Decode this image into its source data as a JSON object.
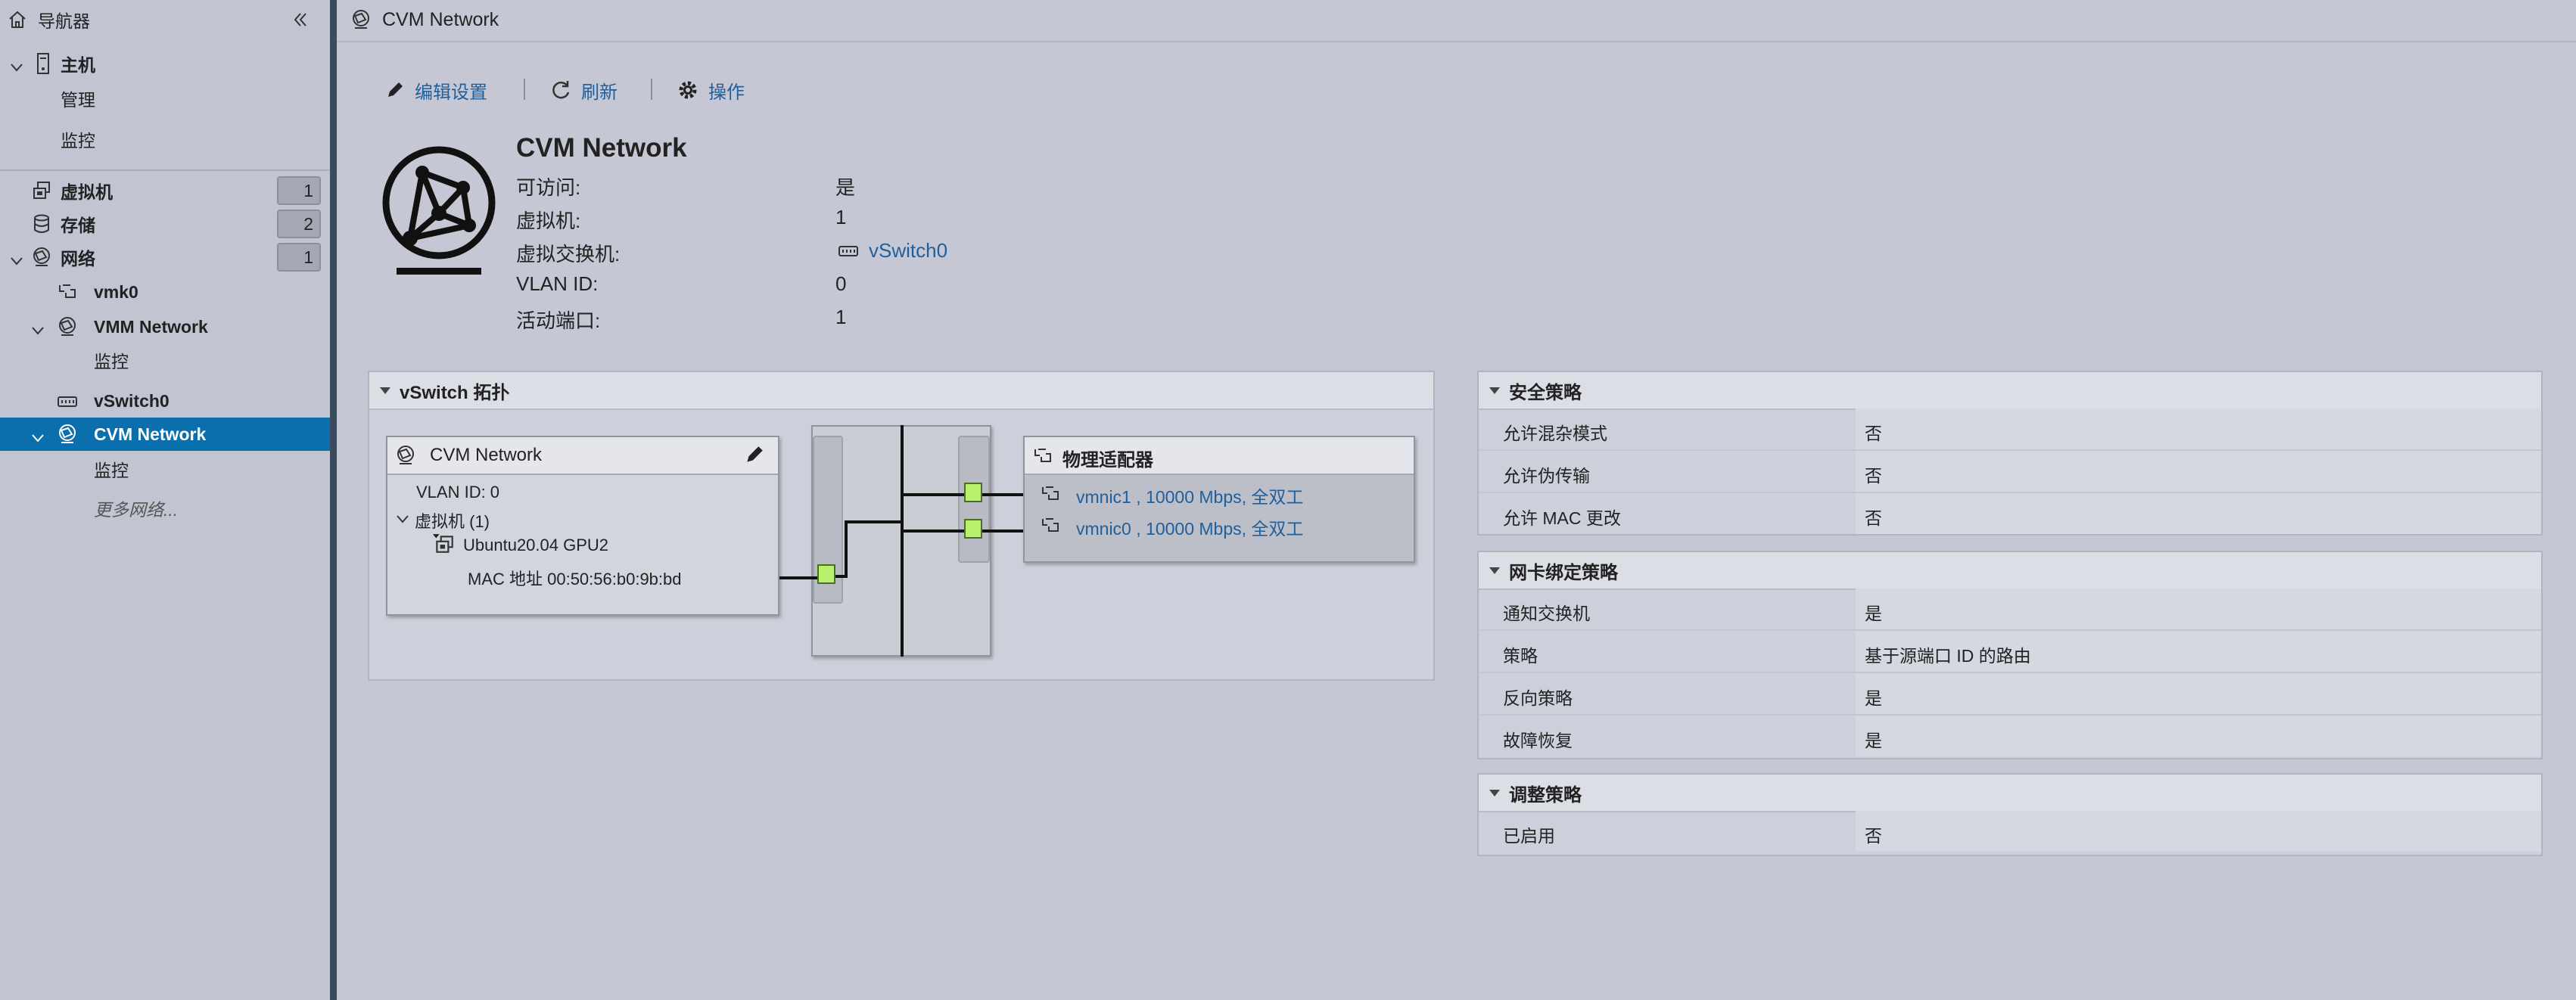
{
  "sidebar": {
    "title": "导航器",
    "host": "主机",
    "host_children": [
      "管理",
      "监控"
    ],
    "vm": {
      "label": "虚拟机",
      "count": "1"
    },
    "storage": {
      "label": "存储",
      "count": "2"
    },
    "network": {
      "label": "网络",
      "count": "1"
    },
    "vmk0": "vmk0",
    "vmm_network": "VMM Network",
    "vmm_monitor": "监控",
    "vswitch0": "vSwitch0",
    "cvm_network": "CVM Network",
    "cvm_monitor": "监控",
    "more": "更多网络..."
  },
  "header": {
    "title": "CVM Network"
  },
  "toolbar": {
    "edit": "编辑设置",
    "refresh": "刷新",
    "actions": "操作"
  },
  "summary": {
    "name": "CVM Network",
    "rows": [
      {
        "key": "可访问:",
        "value": "是"
      },
      {
        "key": "虚拟机:",
        "value": "1"
      },
      {
        "key": "虚拟交换机:",
        "value": "vSwitch0"
      },
      {
        "key": "VLAN ID:",
        "value": "0"
      },
      {
        "key": "活动端口:",
        "value": "1"
      }
    ]
  },
  "topology": {
    "title": "vSwitch 拓扑",
    "portgroup": {
      "name": "CVM Network",
      "vlan": "VLAN ID: 0",
      "vm_group": "虚拟机 (1)",
      "vm_name": "Ubuntu20.04 GPU2",
      "mac": "MAC 地址 00:50:56:b0:9b:bd"
    },
    "adapters": {
      "title": "物理适配器",
      "items": [
        "vmnic1 , 10000 Mbps, 全双工",
        "vmnic0 , 10000 Mbps, 全双工"
      ]
    }
  },
  "security": {
    "title": "安全策略",
    "rows": [
      {
        "key": "允许混杂模式",
        "value": "否"
      },
      {
        "key": "允许伪传输",
        "value": "否"
      },
      {
        "key": "允许 MAC 更改",
        "value": "否"
      }
    ]
  },
  "teaming": {
    "title": "网卡绑定策略",
    "rows": [
      {
        "key": "通知交换机",
        "value": "是"
      },
      {
        "key": "策略",
        "value": "基于源端口 ID 的路由"
      },
      {
        "key": "反向策略",
        "value": "是"
      },
      {
        "key": "故障恢复",
        "value": "是"
      }
    ]
  },
  "shaping": {
    "title": "调整策略",
    "rows": [
      {
        "key": "已启用",
        "value": "否"
      }
    ]
  },
  "colors": {
    "accent": "#0c6fad",
    "link": "#1f5f9c",
    "port": "#b9f06c"
  }
}
